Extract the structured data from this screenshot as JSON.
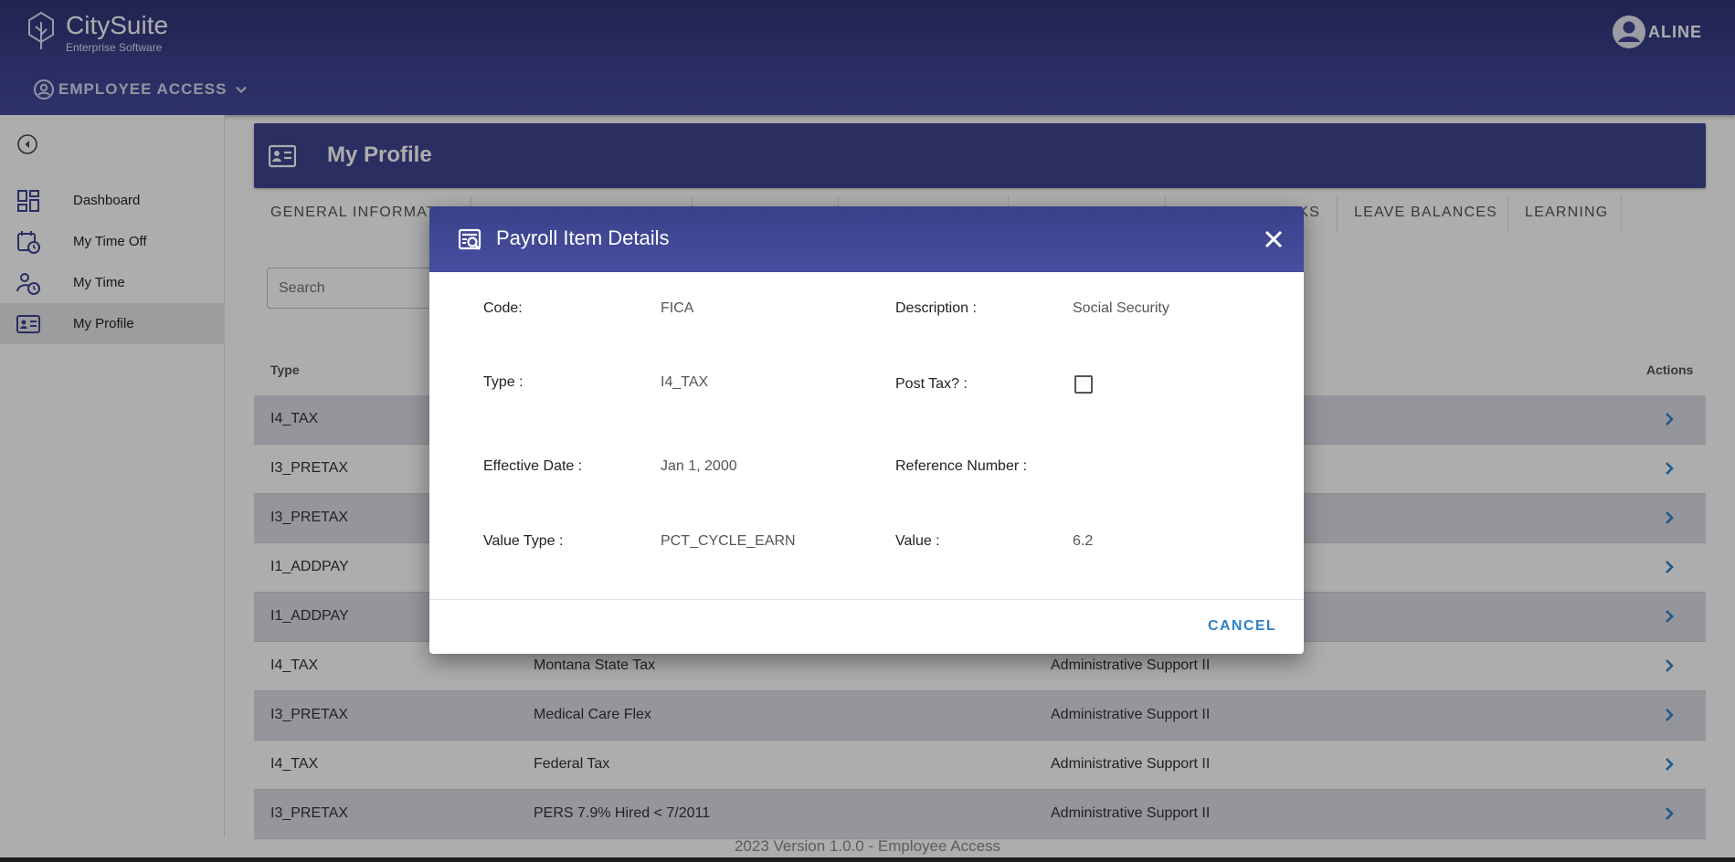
{
  "header": {
    "app_name": "CitySuite",
    "app_subtitle": "Enterprise Software",
    "module_label": "EMPLOYEE ACCESS",
    "user_name": "ALINE"
  },
  "sidebar": {
    "items": [
      {
        "label": "Dashboard",
        "icon": "dashboard-icon"
      },
      {
        "label": "My Time Off",
        "icon": "calendar-clock-icon"
      },
      {
        "label": "My Time",
        "icon": "person-clock-icon"
      },
      {
        "label": "My Profile",
        "icon": "id-card-icon",
        "active": true
      }
    ]
  },
  "page": {
    "title": "My Profile",
    "tabs": [
      "GENERAL INFORMAT",
      "KS",
      "LEAVE BALANCES",
      "LEARNING"
    ],
    "search_placeholder": "Search"
  },
  "table": {
    "columns": {
      "type": "Type",
      "actions": "Actions"
    },
    "rows": [
      {
        "type": "I4_TAX",
        "description": "",
        "position": ""
      },
      {
        "type": "I3_PRETAX",
        "description": "",
        "position": ""
      },
      {
        "type": "I3_PRETAX",
        "description": "",
        "position": ""
      },
      {
        "type": "I1_ADDPAY",
        "description": "",
        "position": ""
      },
      {
        "type": "I1_ADDPAY",
        "description": "",
        "position": ""
      },
      {
        "type": "I4_TAX",
        "description": "Montana State Tax",
        "position": "Administrative Support II"
      },
      {
        "type": "I3_PRETAX",
        "description": "Medical Care Flex",
        "position": "Administrative Support II"
      },
      {
        "type": "I4_TAX",
        "description": "Federal Tax",
        "position": "Administrative Support II"
      },
      {
        "type": "I3_PRETAX",
        "description": "PERS 7.9% Hired < 7/2011",
        "position": "Administrative Support II"
      }
    ]
  },
  "footer": {
    "text": "2023 Version 1.0.0 - Employee Access"
  },
  "dialog": {
    "title": "Payroll Item Details",
    "fields": {
      "code_label": "Code:",
      "code_value": "FICA",
      "description_label": "Description :",
      "description_value": "Social Security",
      "type_label": "Type :",
      "type_value": "I4_TAX",
      "post_tax_label": "Post Tax? :",
      "post_tax_checked": false,
      "effective_date_label": "Effective Date :",
      "effective_date_value": "Jan 1, 2000",
      "reference_number_label": "Reference Number :",
      "reference_number_value": "",
      "value_type_label": "Value Type :",
      "value_type_value": "PCT_CYCLE_EARN",
      "value_label": "Value :",
      "value_value": "6.2"
    },
    "cancel_label": "CANCEL"
  },
  "colors": {
    "header_bg": "#3d4391",
    "accent_blue": "#2d83c9",
    "row_alt": "#dcdde6"
  }
}
